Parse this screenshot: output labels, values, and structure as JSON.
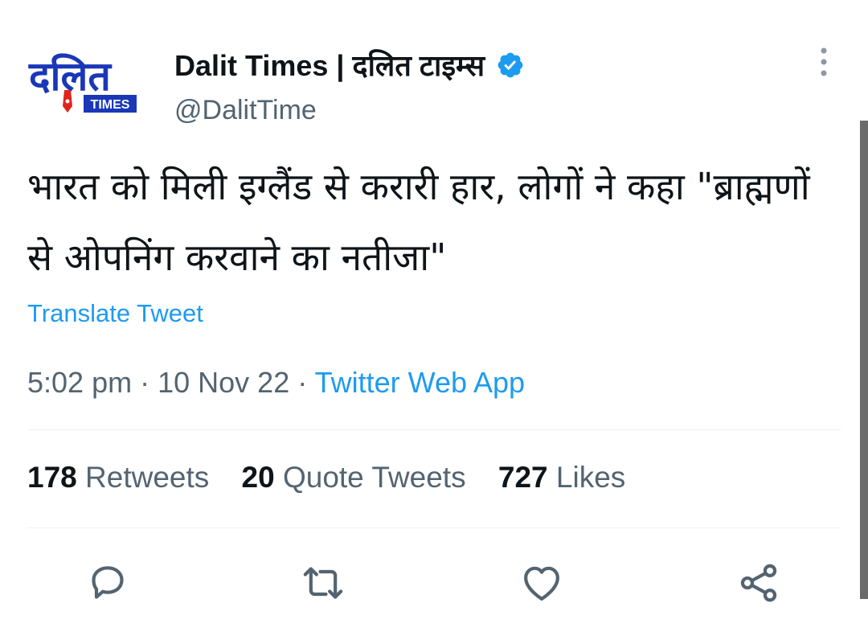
{
  "author": {
    "name": "Dalit Times | दलित टाइम्स",
    "handle": "@DalitTime",
    "verified": true,
    "logo": {
      "text_main": "दलित",
      "text_badge": "TIMES",
      "color": "#1a37b8",
      "accent": "#e0241b"
    }
  },
  "tweet": {
    "text": "भारत को मिली इग्लैंड से करारी हार, लोगों ने कहा \"ब्राह्मणों से ओपनिंग करवाने का नतीजा\"",
    "translate_label": "Translate Tweet",
    "time": "5:02 pm",
    "date": "10 Nov 22",
    "source": "Twitter Web App",
    "separator": "·"
  },
  "stats": {
    "retweets": {
      "count": "178",
      "label": "Retweets"
    },
    "quotes": {
      "count": "20",
      "label": "Quote Tweets"
    },
    "likes": {
      "count": "727",
      "label": "Likes"
    }
  },
  "actions": {
    "reply_icon": "reply-icon",
    "retweet_icon": "retweet-icon",
    "like_icon": "heart-icon",
    "share_icon": "share-icon"
  },
  "colors": {
    "accent": "#1d9bf0",
    "secondary_text": "#536471",
    "primary_text": "#0f1419",
    "icon": "#536471"
  }
}
